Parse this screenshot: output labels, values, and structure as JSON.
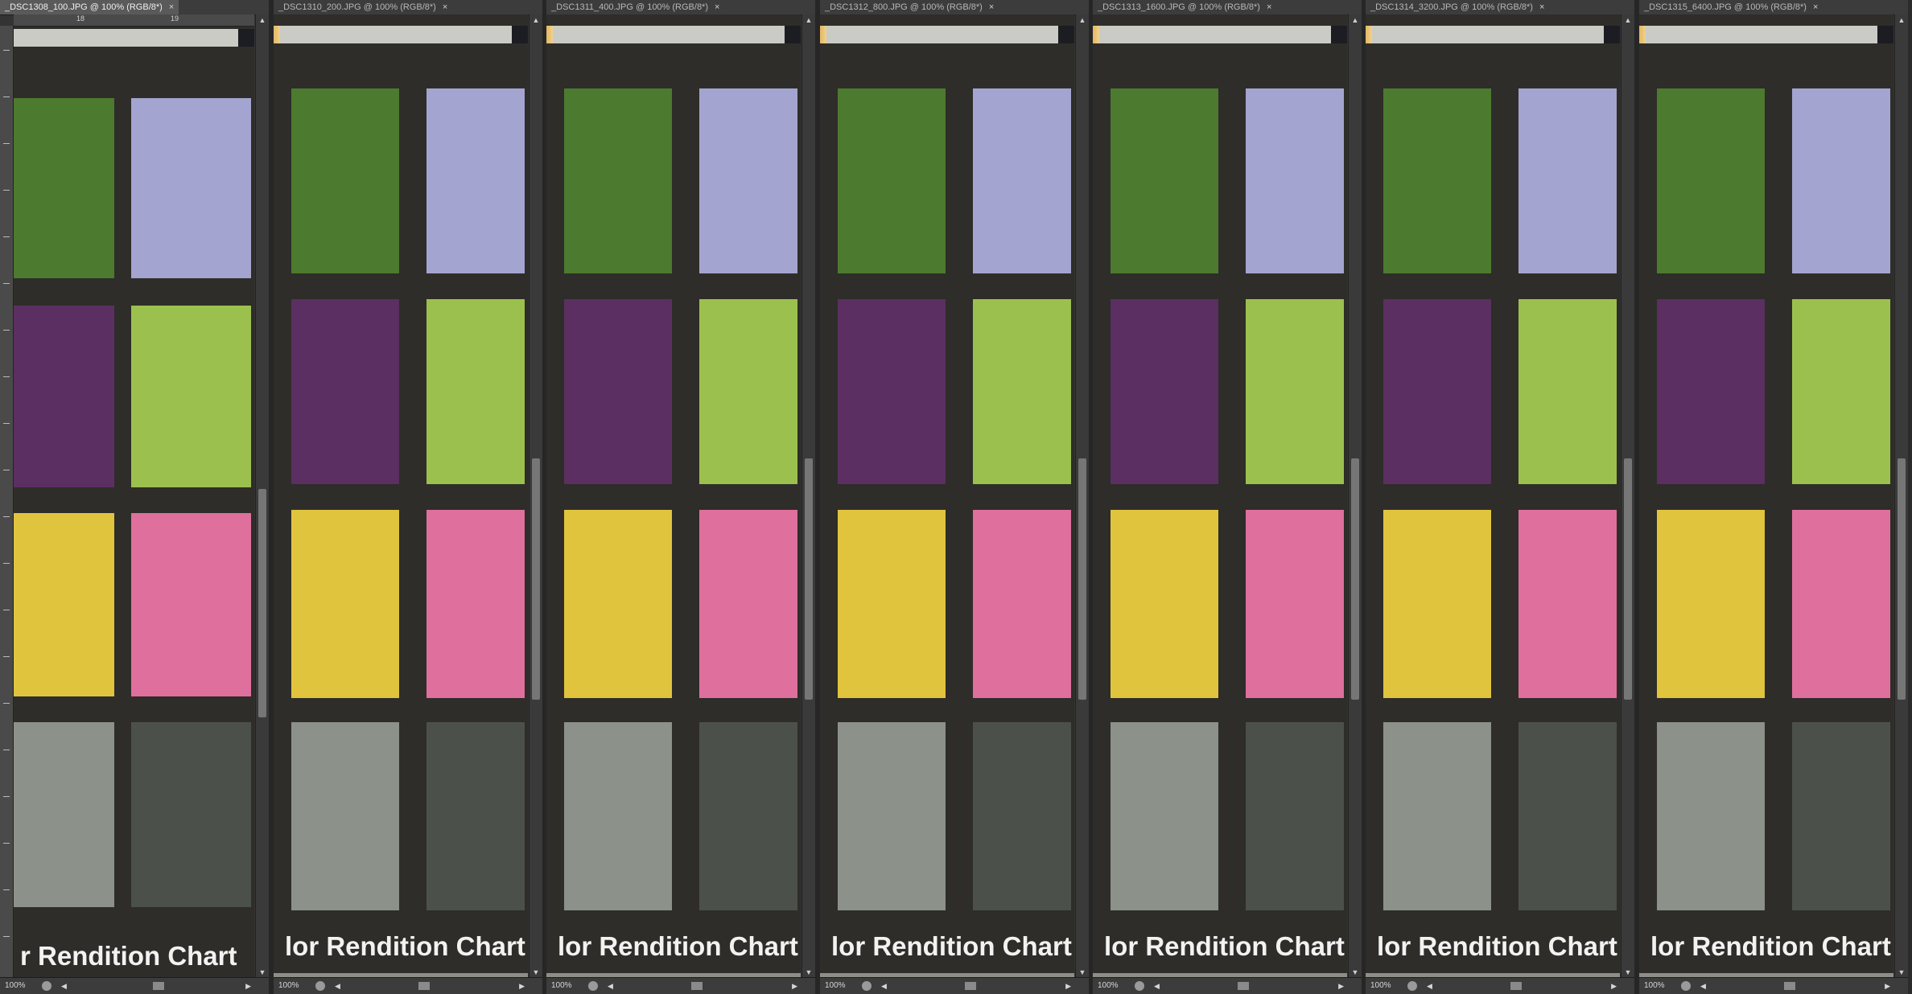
{
  "panels": [
    {
      "title": "_DSC1308_100.JPG @ 100% (RGB/8*)",
      "close": "×",
      "zoom": "100%",
      "chart_text": "r Rendition Chart",
      "ruler_marks": [
        "18",
        "19"
      ]
    },
    {
      "title": "_DSC1310_200.JPG @ 100% (RGB/8*)",
      "close": "×",
      "zoom": "100%",
      "chart_text": "lor Rendition Chart"
    },
    {
      "title": "_DSC1311_400.JPG @ 100% (RGB/8*)",
      "close": "×",
      "zoom": "100%",
      "chart_text": "lor Rendition Chart"
    },
    {
      "title": "_DSC1312_800.JPG @ 100% (RGB/8*)",
      "close": "×",
      "zoom": "100%",
      "chart_text": "lor Rendition Chart"
    },
    {
      "title": "_DSC1313_1600.JPG @ 100% (RGB/8*)",
      "close": "×",
      "zoom": "100%",
      "chart_text": "lor Rendition Chart"
    },
    {
      "title": "_DSC1314_3200.JPG @ 100% (RGB/8*)",
      "close": "×",
      "zoom": "100%",
      "chart_text": "lor Rendition Chart"
    },
    {
      "title": "_DSC1315_6400.JPG @ 100% (RGB/8*)",
      "close": "×",
      "zoom": "100%",
      "chart_text": "lor Rendition Chart"
    }
  ],
  "swatch_colors": {
    "green": "#4c7a2e",
    "lavender": "#a4a4d0",
    "purple": "#5b2f61",
    "yellowgreen": "#9cc04e",
    "yellow": "#e1c43e",
    "pink": "#df6f9d",
    "lightgray": "#8c918a",
    "darkgray": "#4c504a"
  },
  "icons": {
    "close": "close-icon",
    "scroll_up": "arrow-up-icon",
    "scroll_down": "arrow-down-icon",
    "scroll_left": "arrow-left-icon",
    "scroll_right": "arrow-right-icon",
    "status": "status-menu-icon"
  }
}
